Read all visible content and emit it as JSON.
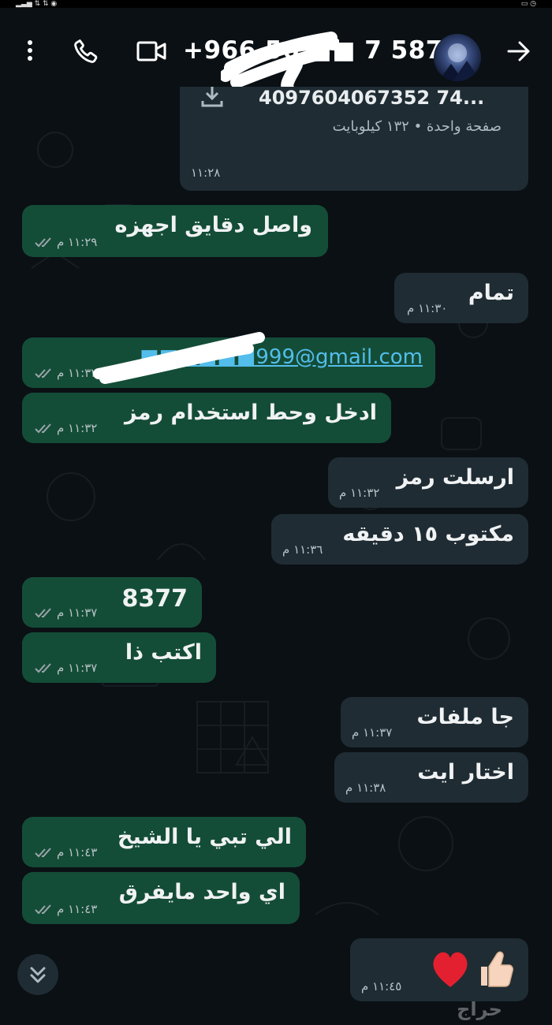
{
  "header": {
    "phone": "+966 56 ■■ 7 5871"
  },
  "file": {
    "name": "4097604067352 74...",
    "info": "صفحة واحدة • ١٣٢ كيلوبايت",
    "time": "١١:٢٨"
  },
  "messages": [
    {
      "text": "واصل دقايق اجهزه",
      "time": "١١:٢٩ م",
      "dir": "out"
    },
    {
      "text": "تمام",
      "time": "١١:٣٠ م",
      "dir": "in"
    },
    {
      "text": "■■■■■■999@gmail.com",
      "time": "١١:٣٢ م",
      "dir": "out"
    },
    {
      "text": "ادخل وحط استخدام رمز",
      "time": "١١:٣٢ م",
      "dir": "out"
    },
    {
      "text": "ارسلت رمز",
      "time": "١١:٣٢ م",
      "dir": "in"
    },
    {
      "text": "مكتوب ١٥ دقيقه",
      "time": "١١:٣٦ م",
      "dir": "in"
    },
    {
      "text": "8377",
      "time": "١١:٣٧ م",
      "dir": "out"
    },
    {
      "text": "اكتب ذا",
      "time": "١١:٣٧ م",
      "dir": "out"
    },
    {
      "text": "جا ملفات",
      "time": "١١:٣٧ م",
      "dir": "in"
    },
    {
      "text": "اختار ايت",
      "time": "١١:٣٨ م",
      "dir": "in"
    },
    {
      "text": "الي تبي يا الشيخ",
      "time": "١١:٤٣ م",
      "dir": "out"
    },
    {
      "text": "اي واحد مايفرق",
      "time": "١١:٤٣ م",
      "dir": "out"
    },
    {
      "text": "❤️👍🏻",
      "time": "١١:٤٥ م",
      "dir": "in"
    }
  ],
  "watermark": "حراج",
  "colors": {
    "background": "#0b1014",
    "outgoing_bubble": "#144d37",
    "incoming_bubble": "#1f2c33",
    "link": "#53bdeb",
    "tick": "#9aa5ab"
  },
  "icons": [
    "more-vert-icon",
    "phone-call-icon",
    "video-call-icon",
    "forward-arrow-icon",
    "download-icon",
    "double-check-icon",
    "scroll-down-icon",
    "heart-icon",
    "thumbs-up-icon"
  ]
}
